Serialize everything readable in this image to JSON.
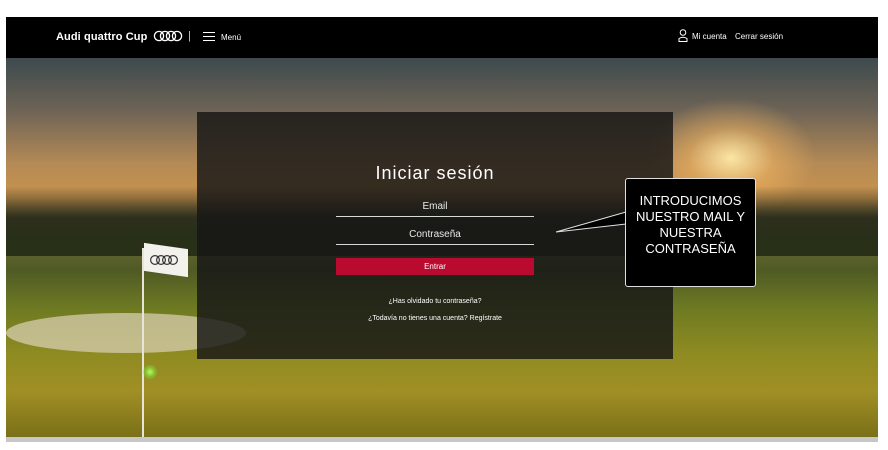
{
  "navbar": {
    "brand": "Audi quattro Cup",
    "separator": "|",
    "menu_label": "Menú",
    "account_label": "Mi cuenta",
    "logout_label": "Cerrar sesión"
  },
  "login": {
    "title": "Iniciar sesión",
    "email_placeholder": "Email",
    "password_placeholder": "Contraseña",
    "submit_label": "Entrar",
    "forgot_link": "¿Has olvidado tu contraseña?",
    "register_link": "¿Todavía no tienes una cuenta? Regístrate"
  },
  "callout": {
    "lines": [
      "INTRODUCIMOS",
      "NUESTRO MAIL Y",
      "NUESTRA",
      "CONTRASEÑA"
    ]
  },
  "colors": {
    "accent": "#bb0a30",
    "navbar_bg": "#000000",
    "panel_bg": "#161616"
  },
  "icons": {
    "brand_logo": "audi-rings-icon",
    "menu": "hamburger-menu-icon",
    "account": "user-icon"
  }
}
